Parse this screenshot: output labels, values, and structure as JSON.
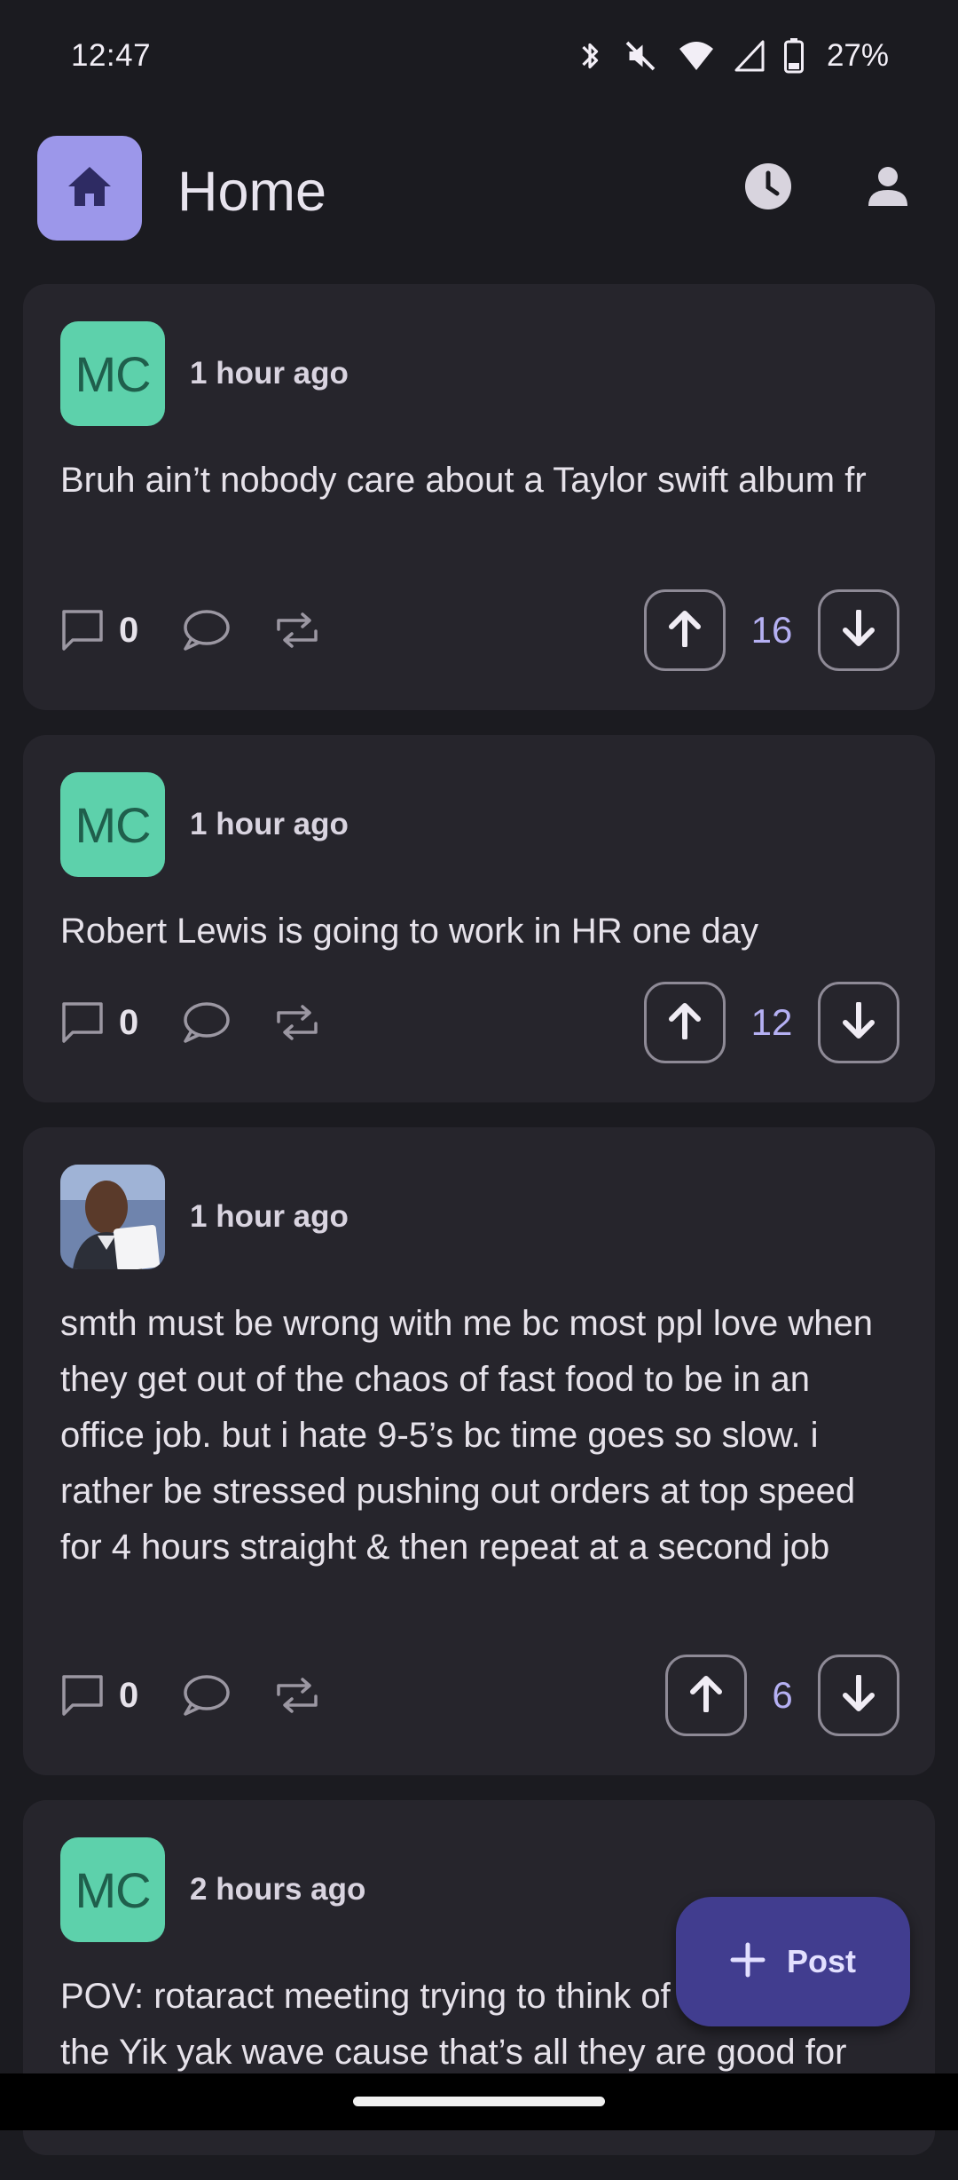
{
  "status_bar": {
    "time": "12:47",
    "battery": "27%",
    "icons": [
      "bluetooth-icon",
      "vibrate-off-icon",
      "wifi-icon",
      "signal-icon",
      "battery-icon"
    ]
  },
  "app_bar": {
    "title": "Home",
    "icons": [
      "home-icon",
      "clock-icon",
      "profile-icon"
    ]
  },
  "colors": {
    "background": "#1b1b20",
    "card": "#26252c",
    "accent": "#9c97ea",
    "avatar": "#5dd1ab",
    "vote_count": "#b5b0f3",
    "fab": "#413d8f"
  },
  "posts": [
    {
      "avatar_text": "MC",
      "time": "1 hour ago",
      "text": "Bruh ain’t nobody care about a Taylor swift album fr",
      "comments": "0",
      "votes": "16"
    },
    {
      "avatar_text": "MC",
      "time": "1 hour ago",
      "text": "Robert Lewis is going to work in HR one day",
      "comments": "0",
      "votes": "12"
    },
    {
      "avatar_text": "",
      "time": "1 hour ago",
      "text": "smth must be wrong with me bc most ppl love when they get out of the chaos of fast food to be in an office job. but i hate 9-5’s bc time goes so slow. i rather be stressed pushing out orders at top speed for 4 hours straight & then repeat at a second job",
      "comments": "0",
      "votes": "6"
    },
    {
      "avatar_text": "MC",
      "time": "2 hours ago",
      "text": "POV: rotaract meeting trying to think of how to get on the Yik yak wave cause that’s all they are good for"
    }
  ],
  "fab": {
    "label": "Post"
  }
}
